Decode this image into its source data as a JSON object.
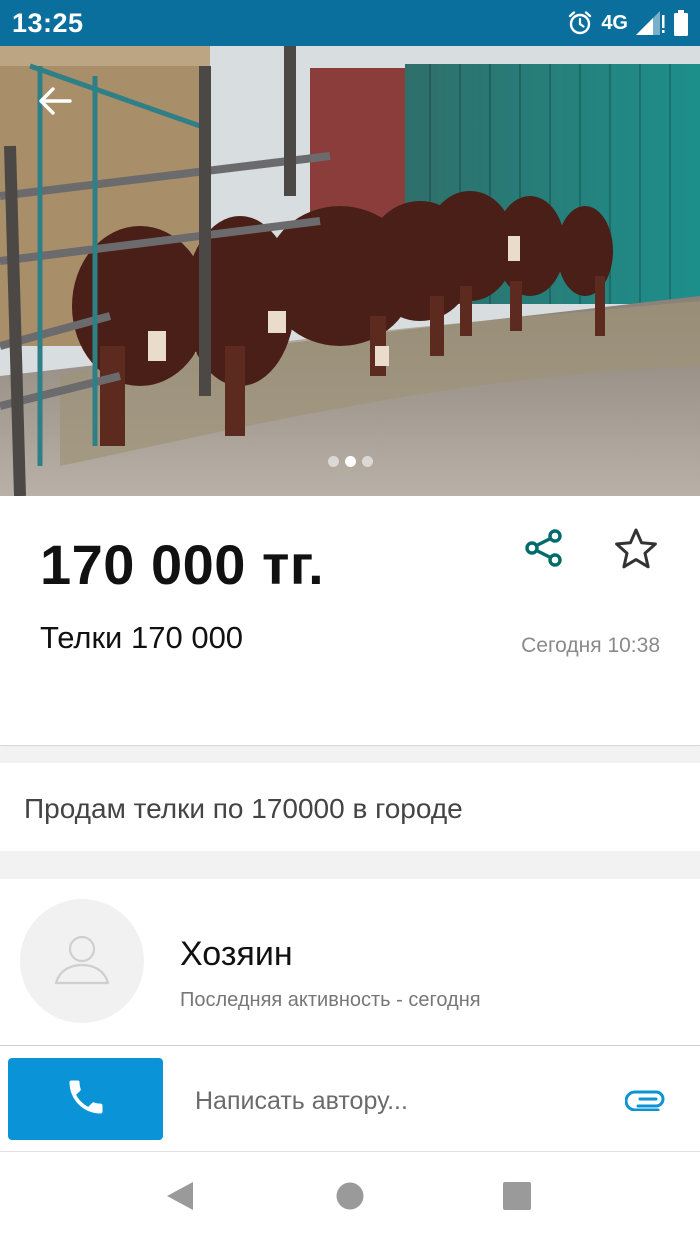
{
  "status_bar": {
    "time": "13:25",
    "network": "4G",
    "icons": [
      "alarm-icon",
      "signal-icon",
      "battery-icon"
    ]
  },
  "photo": {
    "description_icon": "photo-carousel",
    "dots_total": 3,
    "dots_active_index": 1
  },
  "listing": {
    "price": "170 000 тг.",
    "title": "Телки 170 000",
    "posted": "Сегодня 10:38",
    "description": "Продам телки по 170000 в городе"
  },
  "seller": {
    "name": "Хозяин",
    "activity": "Последняя активность - сегодня"
  },
  "message": {
    "placeholder": "Написать автору..."
  },
  "colors": {
    "status_bar": "#0b6f9d",
    "accent": "#0a93d6",
    "share_icon": "#006b6b"
  },
  "icons": {
    "back": "arrow-back-icon",
    "share": "share-icon",
    "favorite": "star-outline-icon",
    "call": "phone-icon",
    "attach": "paperclip-icon",
    "nav": [
      "nav-back-icon",
      "nav-home-icon",
      "nav-recents-icon"
    ]
  }
}
